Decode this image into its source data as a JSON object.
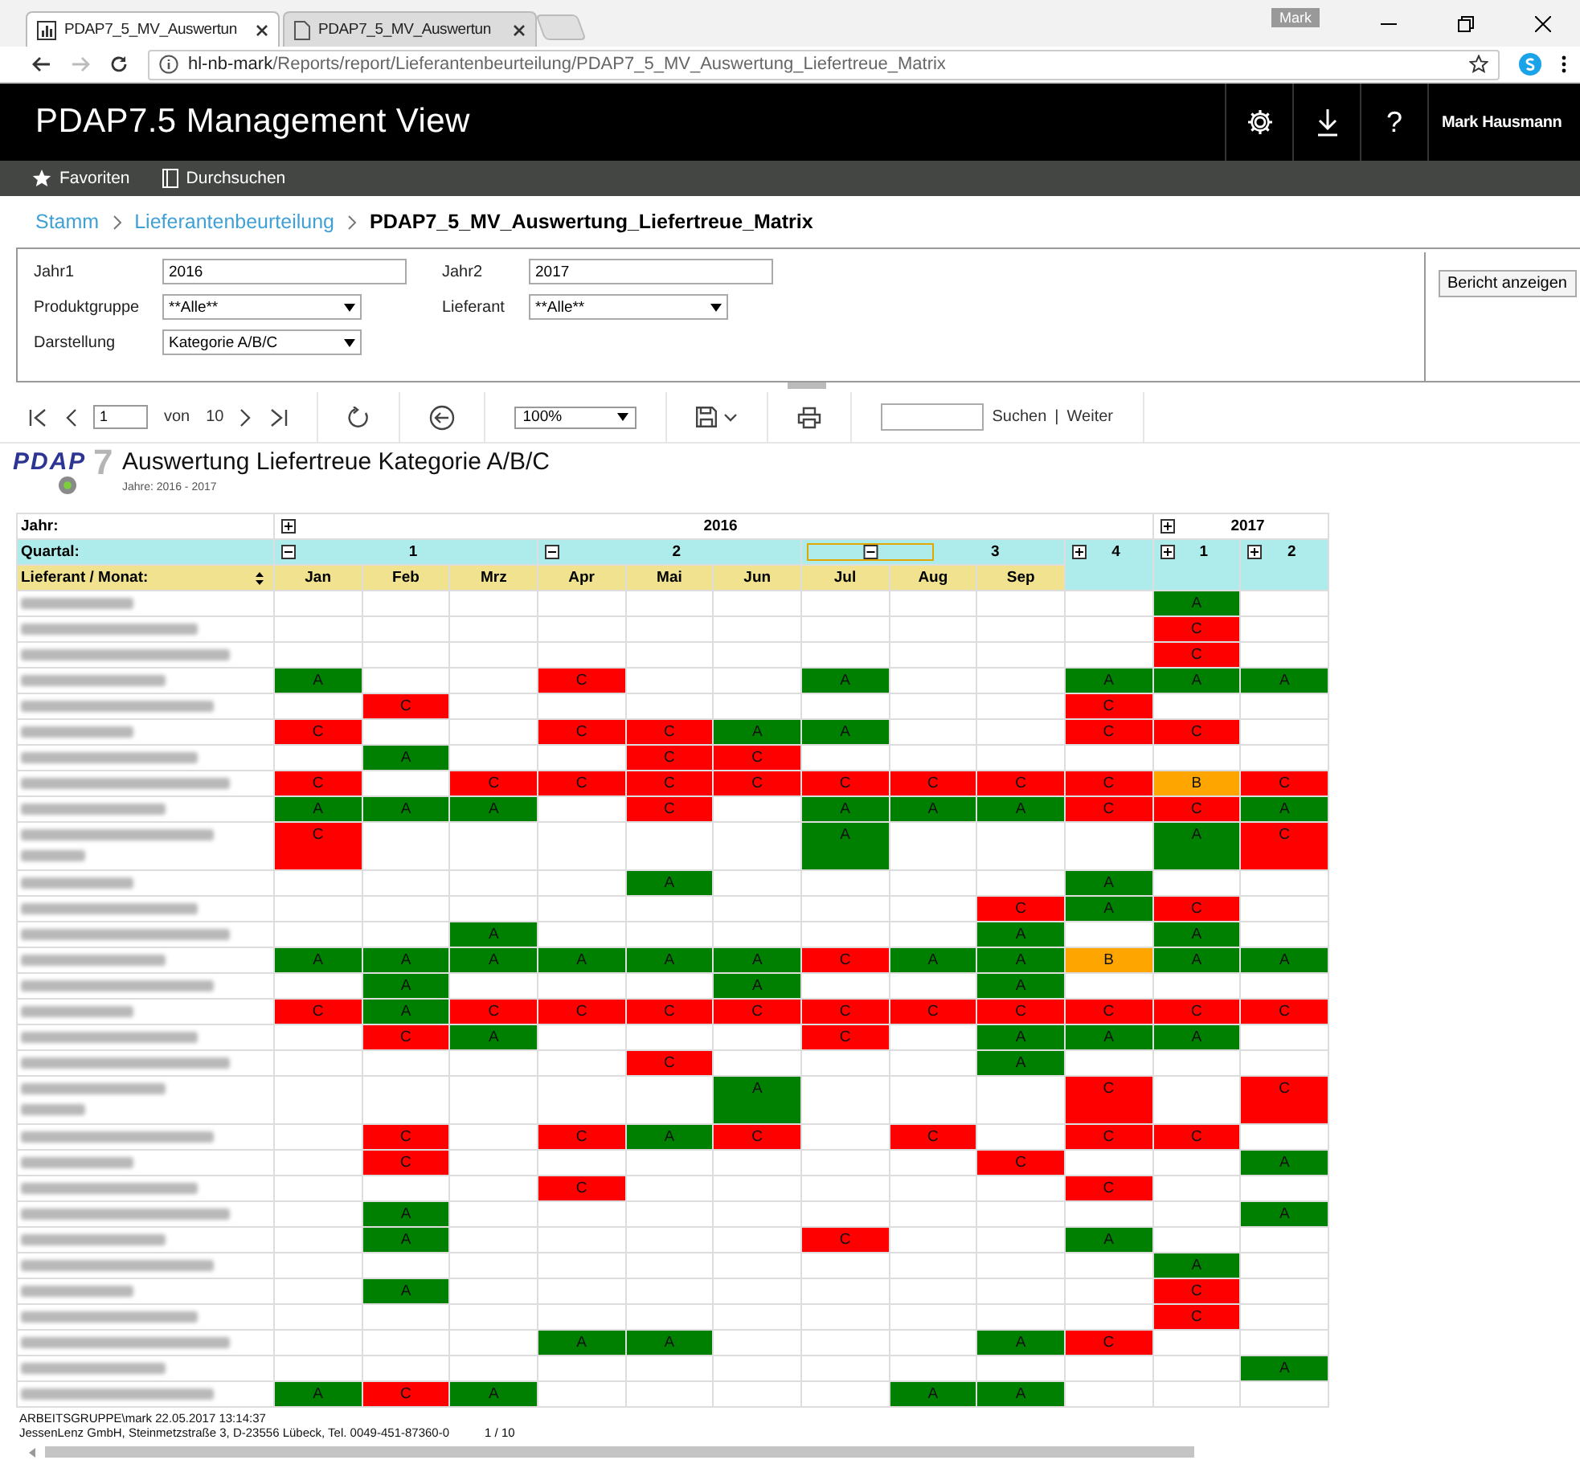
{
  "browser": {
    "tabs": [
      {
        "title": "PDAP7_5_MV_Auswertun",
        "selected": true
      },
      {
        "title": "PDAP7_5_MV_Auswertun",
        "selected": false
      }
    ],
    "profile": "Mark",
    "url_host": "hl-nb-mark",
    "url_path": "/Reports/report/Lieferantenbeurteilung/PDAP7_5_MV_Auswertung_Liefertreue_Matrix"
  },
  "app": {
    "title": "PDAP7.5 Management View",
    "help": "?",
    "user": "Mark Hausmann",
    "nav": [
      "Favoriten",
      "Durchsuchen"
    ]
  },
  "breadcrumb": [
    "Stamm",
    "Lieferantenbeurteilung",
    "PDAP7_5_MV_Auswertung_Liefertreue_Matrix"
  ],
  "parameters": [
    {
      "label": "Jahr1",
      "kind": "text",
      "value": "2016"
    },
    {
      "label": "Jahr2",
      "kind": "text",
      "value": "2017"
    },
    {
      "label": "Produktgruppe",
      "kind": "select",
      "value": "**Alle**"
    },
    {
      "label": "Lieferant",
      "kind": "select",
      "value": "**Alle**"
    },
    {
      "label": "Darstellung",
      "kind": "select",
      "value": "Kategorie A/B/C"
    }
  ],
  "view_button": "Bericht anzeigen",
  "toolbar": {
    "page": "1",
    "of_label": "von",
    "pages": "10",
    "zoom": "100%",
    "find_label": "Suchen",
    "separator": "|",
    "next_label": "Weiter"
  },
  "report": {
    "logo": "PDAP",
    "logo_mark": "7",
    "title": "Auswertung Liefertreue Kategorie A/B/C",
    "subtitle": "Jahre: 2016 - 2017",
    "year_label": "Jahr:",
    "quarter_label": "Quartal:",
    "month_label": "Lieferant / Monat:",
    "years": [
      {
        "label": "2016",
        "expanded": false,
        "quarters": [
          {
            "label": "1",
            "expanded": true,
            "highlighted": false,
            "months": [
              "Jan",
              "Feb",
              "Mrz"
            ]
          },
          {
            "label": "2",
            "expanded": true,
            "highlighted": false,
            "months": [
              "Apr",
              "Mai",
              "Jun"
            ]
          },
          {
            "label": "3",
            "expanded": true,
            "highlighted": true,
            "months": [
              "Jul",
              "Aug",
              "Sep"
            ]
          },
          {
            "label": "4",
            "expanded": false,
            "highlighted": false
          }
        ]
      },
      {
        "label": "2017",
        "expanded": false,
        "quarters": [
          {
            "label": "1",
            "expanded": false,
            "highlighted": false
          },
          {
            "label": "2",
            "expanded": false,
            "highlighted": false
          }
        ]
      }
    ],
    "rows": [
      {
        "tall": false,
        "cells": [
          null,
          null,
          null,
          null,
          null,
          null,
          null,
          null,
          null,
          null,
          {
            "text": "A",
            "color": "#008000"
          },
          null
        ]
      },
      {
        "tall": false,
        "cells": [
          null,
          null,
          null,
          null,
          null,
          null,
          null,
          null,
          null,
          null,
          {
            "text": "C",
            "color": "#ff0000"
          },
          null
        ]
      },
      {
        "tall": false,
        "cells": [
          null,
          null,
          null,
          null,
          null,
          null,
          null,
          null,
          null,
          null,
          {
            "text": "C",
            "color": "#ff0000"
          },
          null
        ]
      },
      {
        "tall": false,
        "cells": [
          {
            "text": "A",
            "color": "#008000"
          },
          null,
          null,
          {
            "text": "C",
            "color": "#ff0000"
          },
          null,
          null,
          {
            "text": "A",
            "color": "#008000"
          },
          null,
          null,
          {
            "text": "A",
            "color": "#008000"
          },
          {
            "text": "A",
            "color": "#008000"
          },
          {
            "text": "A",
            "color": "#008000"
          }
        ]
      },
      {
        "tall": false,
        "cells": [
          null,
          {
            "text": "C",
            "color": "#ff0000"
          },
          null,
          null,
          null,
          null,
          null,
          null,
          null,
          {
            "text": "C",
            "color": "#ff0000"
          },
          null,
          null
        ]
      },
      {
        "tall": false,
        "cells": [
          {
            "text": "C",
            "color": "#ff0000"
          },
          null,
          null,
          {
            "text": "C",
            "color": "#ff0000"
          },
          {
            "text": "C",
            "color": "#ff0000"
          },
          {
            "text": "A",
            "color": "#008000"
          },
          {
            "text": "A",
            "color": "#008000"
          },
          null,
          null,
          {
            "text": "C",
            "color": "#ff0000"
          },
          {
            "text": "C",
            "color": "#ff0000"
          },
          null
        ]
      },
      {
        "tall": false,
        "cells": [
          null,
          {
            "text": "A",
            "color": "#008000"
          },
          null,
          null,
          {
            "text": "C",
            "color": "#ff0000"
          },
          {
            "text": "C",
            "color": "#ff0000"
          },
          null,
          null,
          null,
          null,
          null,
          null
        ]
      },
      {
        "tall": false,
        "cells": [
          {
            "text": "C",
            "color": "#ff0000"
          },
          null,
          {
            "text": "C",
            "color": "#ff0000"
          },
          {
            "text": "C",
            "color": "#ff0000"
          },
          {
            "text": "C",
            "color": "#ff0000"
          },
          {
            "text": "C",
            "color": "#ff0000"
          },
          {
            "text": "C",
            "color": "#ff0000"
          },
          {
            "text": "C",
            "color": "#ff0000"
          },
          {
            "text": "C",
            "color": "#ff0000"
          },
          {
            "text": "C",
            "color": "#ff0000"
          },
          {
            "text": "B",
            "color": "#ffa500"
          },
          {
            "text": "C",
            "color": "#ff0000"
          }
        ]
      },
      {
        "tall": false,
        "cells": [
          {
            "text": "A",
            "color": "#008000"
          },
          {
            "text": "A",
            "color": "#008000"
          },
          {
            "text": "A",
            "color": "#008000"
          },
          null,
          {
            "text": "C",
            "color": "#ff0000"
          },
          null,
          {
            "text": "A",
            "color": "#008000"
          },
          {
            "text": "A",
            "color": "#008000"
          },
          {
            "text": "A",
            "color": "#008000"
          },
          {
            "text": "C",
            "color": "#ff0000"
          },
          {
            "text": "C",
            "color": "#ff0000"
          },
          {
            "text": "A",
            "color": "#008000"
          }
        ]
      },
      {
        "tall": true,
        "cells": [
          {
            "text": "C",
            "color": "#ff0000"
          },
          null,
          null,
          null,
          null,
          null,
          {
            "text": "A",
            "color": "#008000"
          },
          null,
          null,
          null,
          {
            "text": "A",
            "color": "#008000"
          },
          {
            "text": "C",
            "color": "#ff0000"
          }
        ]
      },
      {
        "tall": false,
        "cells": [
          null,
          null,
          null,
          null,
          {
            "text": "A",
            "color": "#008000"
          },
          null,
          null,
          null,
          null,
          {
            "text": "A",
            "color": "#008000"
          },
          null,
          null
        ]
      },
      {
        "tall": false,
        "cells": [
          null,
          null,
          null,
          null,
          null,
          null,
          null,
          null,
          {
            "text": "C",
            "color": "#ff0000"
          },
          {
            "text": "A",
            "color": "#008000"
          },
          {
            "text": "C",
            "color": "#ff0000"
          },
          null
        ]
      },
      {
        "tall": false,
        "cells": [
          null,
          null,
          {
            "text": "A",
            "color": "#008000"
          },
          null,
          null,
          null,
          null,
          null,
          {
            "text": "A",
            "color": "#008000"
          },
          null,
          {
            "text": "A",
            "color": "#008000"
          },
          null
        ]
      },
      {
        "tall": false,
        "cells": [
          {
            "text": "A",
            "color": "#008000"
          },
          {
            "text": "A",
            "color": "#008000"
          },
          {
            "text": "A",
            "color": "#008000"
          },
          {
            "text": "A",
            "color": "#008000"
          },
          {
            "text": "A",
            "color": "#008000"
          },
          {
            "text": "A",
            "color": "#008000"
          },
          {
            "text": "C",
            "color": "#ff0000"
          },
          {
            "text": "A",
            "color": "#008000"
          },
          {
            "text": "A",
            "color": "#008000"
          },
          {
            "text": "B",
            "color": "#ffa500"
          },
          {
            "text": "A",
            "color": "#008000"
          },
          {
            "text": "A",
            "color": "#008000"
          }
        ]
      },
      {
        "tall": false,
        "cells": [
          null,
          {
            "text": "A",
            "color": "#008000"
          },
          null,
          null,
          null,
          {
            "text": "A",
            "color": "#008000"
          },
          null,
          null,
          {
            "text": "A",
            "color": "#008000"
          },
          null,
          null,
          null
        ]
      },
      {
        "tall": false,
        "cells": [
          {
            "text": "C",
            "color": "#ff0000"
          },
          {
            "text": "A",
            "color": "#008000"
          },
          {
            "text": "C",
            "color": "#ff0000"
          },
          {
            "text": "C",
            "color": "#ff0000"
          },
          {
            "text": "C",
            "color": "#ff0000"
          },
          {
            "text": "C",
            "color": "#ff0000"
          },
          {
            "text": "C",
            "color": "#ff0000"
          },
          {
            "text": "C",
            "color": "#ff0000"
          },
          {
            "text": "C",
            "color": "#ff0000"
          },
          {
            "text": "C",
            "color": "#ff0000"
          },
          {
            "text": "C",
            "color": "#ff0000"
          },
          {
            "text": "C",
            "color": "#ff0000"
          }
        ]
      },
      {
        "tall": false,
        "cells": [
          null,
          {
            "text": "C",
            "color": "#ff0000"
          },
          {
            "text": "A",
            "color": "#008000"
          },
          null,
          null,
          null,
          {
            "text": "C",
            "color": "#ff0000"
          },
          null,
          {
            "text": "A",
            "color": "#008000"
          },
          {
            "text": "A",
            "color": "#008000"
          },
          {
            "text": "A",
            "color": "#008000"
          },
          null
        ]
      },
      {
        "tall": false,
        "cells": [
          null,
          null,
          null,
          null,
          {
            "text": "C",
            "color": "#ff0000"
          },
          null,
          null,
          null,
          {
            "text": "A",
            "color": "#008000"
          },
          null,
          null,
          null
        ]
      },
      {
        "tall": true,
        "cells": [
          null,
          null,
          null,
          null,
          null,
          {
            "text": "A",
            "color": "#008000"
          },
          null,
          null,
          null,
          {
            "text": "C",
            "color": "#ff0000"
          },
          null,
          {
            "text": "C",
            "color": "#ff0000"
          }
        ]
      },
      {
        "tall": false,
        "cells": [
          null,
          {
            "text": "C",
            "color": "#ff0000"
          },
          null,
          {
            "text": "C",
            "color": "#ff0000"
          },
          {
            "text": "A",
            "color": "#008000"
          },
          {
            "text": "C",
            "color": "#ff0000"
          },
          null,
          {
            "text": "C",
            "color": "#ff0000"
          },
          null,
          {
            "text": "C",
            "color": "#ff0000"
          },
          {
            "text": "C",
            "color": "#ff0000"
          },
          null
        ]
      },
      {
        "tall": false,
        "cells": [
          null,
          {
            "text": "C",
            "color": "#ff0000"
          },
          null,
          null,
          null,
          null,
          null,
          null,
          {
            "text": "C",
            "color": "#ff0000"
          },
          null,
          null,
          {
            "text": "A",
            "color": "#008000"
          }
        ]
      },
      {
        "tall": false,
        "cells": [
          null,
          null,
          null,
          {
            "text": "C",
            "color": "#ff0000"
          },
          null,
          null,
          null,
          null,
          null,
          {
            "text": "C",
            "color": "#ff0000"
          },
          null,
          null
        ]
      },
      {
        "tall": false,
        "cells": [
          null,
          {
            "text": "A",
            "color": "#008000"
          },
          null,
          null,
          null,
          null,
          null,
          null,
          null,
          null,
          null,
          {
            "text": "A",
            "color": "#008000"
          }
        ]
      },
      {
        "tall": false,
        "cells": [
          null,
          {
            "text": "A",
            "color": "#008000"
          },
          null,
          null,
          null,
          null,
          {
            "text": "C",
            "color": "#ff0000"
          },
          null,
          null,
          {
            "text": "A",
            "color": "#008000"
          },
          null,
          null
        ]
      },
      {
        "tall": false,
        "cells": [
          null,
          null,
          null,
          null,
          null,
          null,
          null,
          null,
          null,
          null,
          {
            "text": "A",
            "color": "#008000"
          },
          null
        ]
      },
      {
        "tall": false,
        "cells": [
          null,
          {
            "text": "A",
            "color": "#008000"
          },
          null,
          null,
          null,
          null,
          null,
          null,
          null,
          null,
          {
            "text": "C",
            "color": "#ff0000"
          },
          null
        ]
      },
      {
        "tall": false,
        "cells": [
          null,
          null,
          null,
          null,
          null,
          null,
          null,
          null,
          null,
          null,
          {
            "text": "C",
            "color": "#ff0000"
          },
          null
        ]
      },
      {
        "tall": false,
        "cells": [
          null,
          null,
          null,
          {
            "text": "A",
            "color": "#008000"
          },
          {
            "text": "A",
            "color": "#008000"
          },
          null,
          null,
          null,
          {
            "text": "A",
            "color": "#008000"
          },
          {
            "text": "C",
            "color": "#ff0000"
          },
          null,
          null
        ]
      },
      {
        "tall": false,
        "cells": [
          null,
          null,
          null,
          null,
          null,
          null,
          null,
          null,
          null,
          null,
          null,
          {
            "text": "A",
            "color": "#008000"
          }
        ]
      },
      {
        "tall": false,
        "cells": [
          {
            "text": "A",
            "color": "#008000"
          },
          {
            "text": "C",
            "color": "#ff0000"
          },
          {
            "text": "A",
            "color": "#008000"
          },
          null,
          null,
          null,
          null,
          {
            "text": "A",
            "color": "#008000"
          },
          {
            "text": "A",
            "color": "#008000"
          },
          null,
          null,
          null
        ]
      }
    ],
    "footer_user": "ARBEITSGRUPPE\\mark 22.05.2017 13:14:37",
    "footer_company": "JessenLenz GmbH, Steinmetzstraße 3, D-23556 Lübeck, Tel. 0049-451-87360-0",
    "footer_page": "1 / 10"
  }
}
